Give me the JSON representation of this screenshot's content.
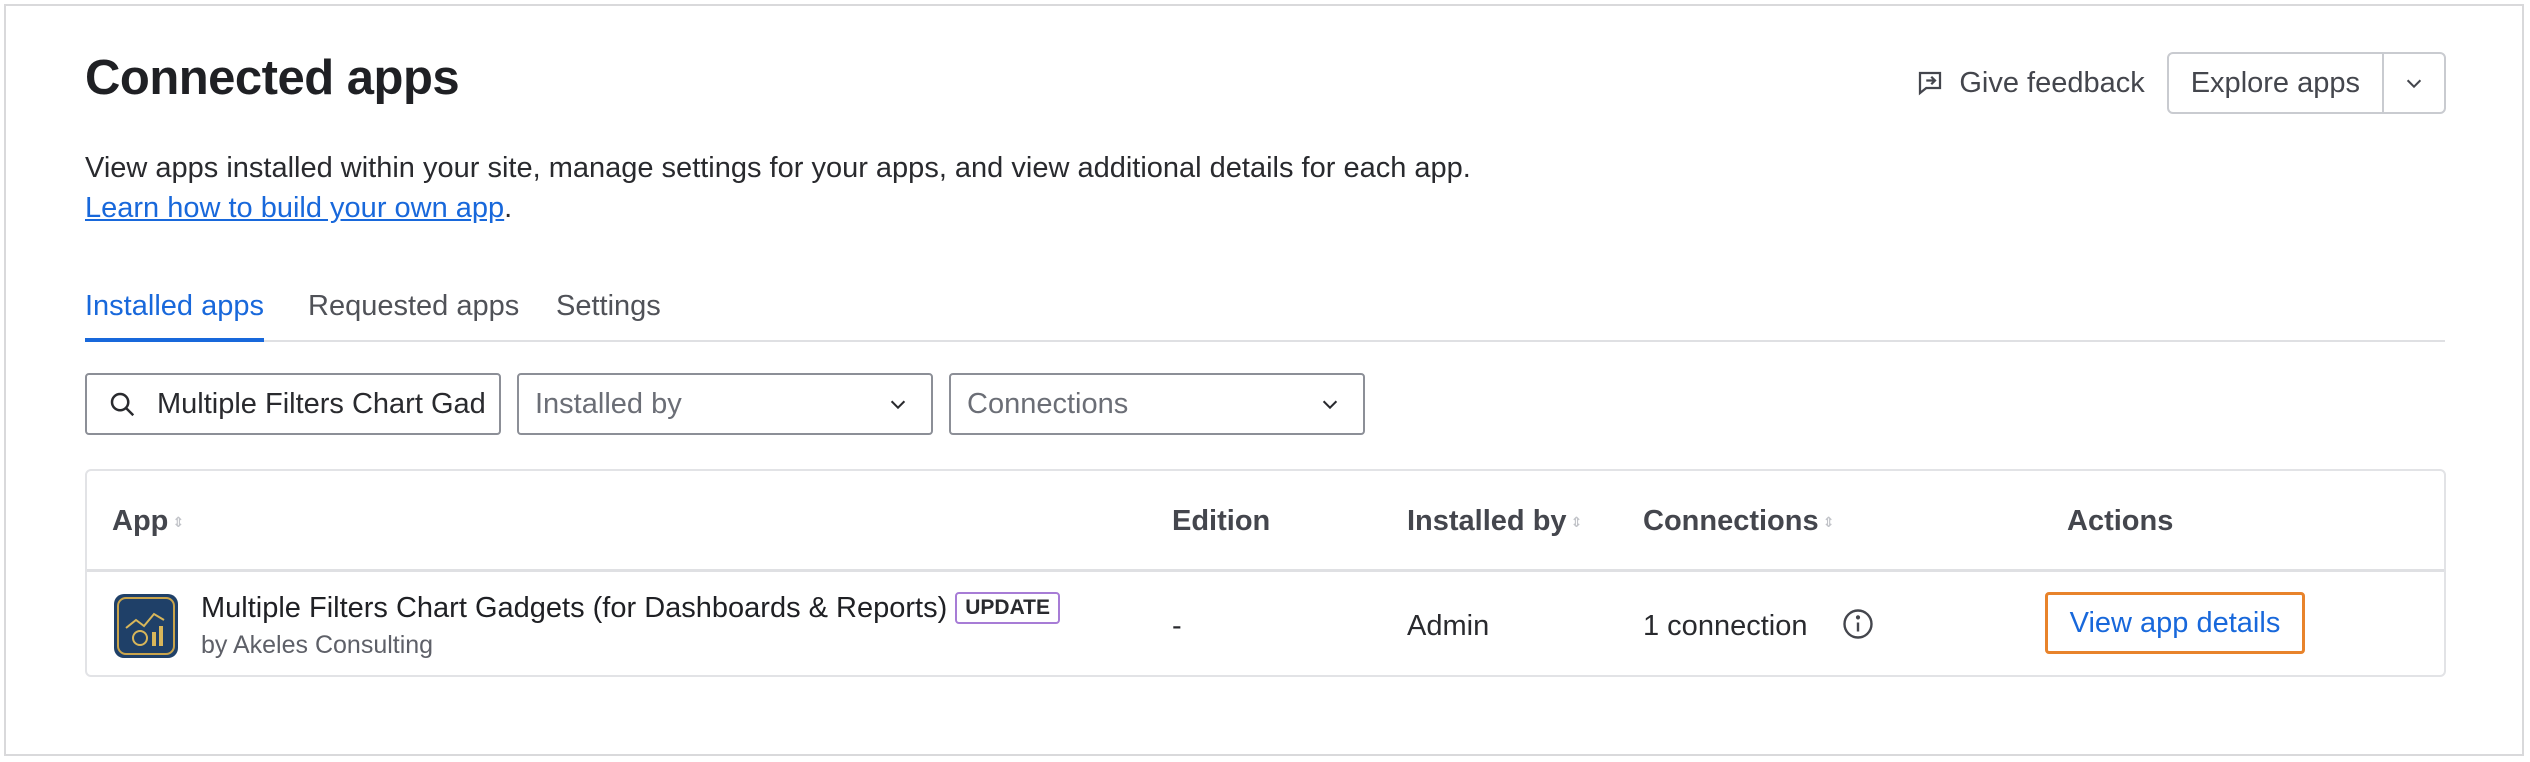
{
  "header": {
    "title": "Connected apps",
    "feedback_label": "Give feedback",
    "explore_label": "Explore apps"
  },
  "description": {
    "text": "View apps installed within your site, manage settings for your apps, and view additional details for each app.",
    "link_text": "Learn how to build your own app",
    "link_suffix": "."
  },
  "tabs": [
    {
      "label": "Installed apps",
      "active": true
    },
    {
      "label": "Requested apps",
      "active": false
    },
    {
      "label": "Settings",
      "active": false
    }
  ],
  "filters": {
    "search_value": "Multiple Filters Chart Gadgets (for Dashboards & Reports)",
    "installed_by_placeholder": "Installed by",
    "connections_placeholder": "Connections"
  },
  "table": {
    "columns": [
      "App",
      "Edition",
      "Installed by",
      "Connections",
      "Actions"
    ],
    "rows": [
      {
        "app_name": "Multiple Filters Chart Gadgets (for Dashboards & Reports)",
        "badge": "UPDATE",
        "vendor": "by Akeles Consulting",
        "edition": "-",
        "installed_by": "Admin",
        "connections": "1 connection",
        "action": "View app details"
      }
    ]
  },
  "colors": {
    "accent": "#1868db",
    "badge_border": "#a77cd6",
    "focus_outline": "#e8832b"
  }
}
